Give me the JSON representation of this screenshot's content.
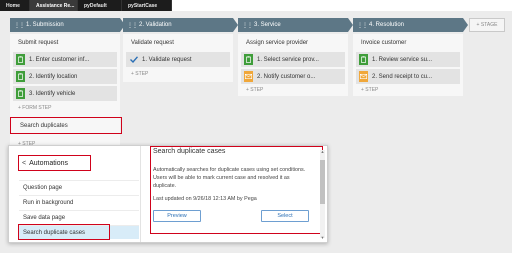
{
  "tabs": [
    "Home",
    "Assistance Re...",
    "pyDefault",
    "pyStartCase"
  ],
  "stages": [
    {
      "label": "1.  Submission"
    },
    {
      "label": "2.  Validation"
    },
    {
      "label": "3.  Service"
    },
    {
      "label": "4.  Resolution"
    }
  ],
  "add_stage": "+ STAGE",
  "col1": {
    "process": "Submit request",
    "steps": [
      "1.   Enter customer inf...",
      "2.   Identify location",
      "3.   Identify vehicle"
    ],
    "form_step": "+ FORM STEP",
    "new_step_input": "Search duplicates",
    "add_step": "+ STEP"
  },
  "col2": {
    "process": "Validate request",
    "steps": [
      "1.   Validate request"
    ],
    "add_step": "+ STEP"
  },
  "col3": {
    "process": "Assign service provider",
    "steps": [
      "1.   Select service prov...",
      "2.   Notify customer o..."
    ],
    "add_step": "+ STEP"
  },
  "col4": {
    "process": "Invoice customer",
    "steps": [
      "1.   Review service su...",
      "2.   Send receipt to cu..."
    ],
    "add_step": "+ STEP"
  },
  "popover": {
    "back_label": "Automations",
    "items": [
      "Question page",
      "Run in background",
      "Save data page",
      "Search duplicate cases"
    ],
    "selected": "Search duplicate cases",
    "title": "Search duplicate cases",
    "description": "Automatically searches for duplicate cases using set conditions. Users will be able to mark current case and resolved it as duplicate.",
    "updated": "Last updated on 9/26/18 12:13 AM by Pega",
    "preview_button": "Preview",
    "select_button": "Select"
  },
  "colors": {
    "stage": "#5d7786",
    "highlight": "#d0021b",
    "green": "#3f9d3a",
    "orange": "#f0a73a",
    "link": "#2a6fb5"
  }
}
